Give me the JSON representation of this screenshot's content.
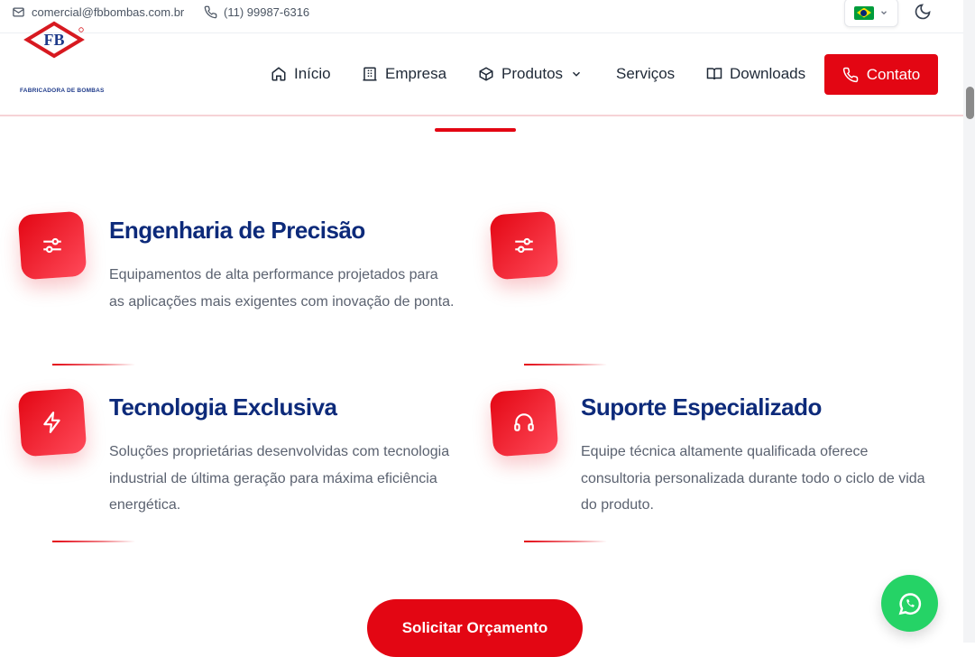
{
  "topbar": {
    "email": "comercial@fbbombas.com.br",
    "phone": "(11) 99987-6316"
  },
  "brand": {
    "logo_letters": "FB",
    "tagline": "FABRICADORA DE BOMBAS"
  },
  "nav": {
    "items": [
      {
        "label": "Início",
        "icon": "home-icon"
      },
      {
        "label": "Empresa",
        "icon": "building-icon"
      },
      {
        "label": "Produtos",
        "icon": "package-icon"
      },
      {
        "label": "Serviços",
        "icon": ""
      },
      {
        "label": "Downloads",
        "icon": "book-icon"
      }
    ],
    "contact_label": "Contato"
  },
  "features": [
    {
      "icon": "sliders-icon",
      "title": "Engenharia de Precisão",
      "description": "Equipamentos de alta performance projetados para as aplicações mais exigentes com inovação de ponta."
    },
    {
      "icon": "sliders-icon",
      "title": "",
      "description": ""
    },
    {
      "icon": "lightning-icon",
      "title": "Tecnologia Exclusiva",
      "description": "Soluções proprietárias desenvolvidas com tecnologia industrial de última geração para máxima eficiência energética."
    },
    {
      "icon": "headset-icon",
      "title": "Suporte Especializado",
      "description": "Equipe técnica altamente qualificada oferece consultoria personalizada durante todo o ciclo de vida do produto."
    }
  ],
  "cta_label": "Solicitar Orçamento",
  "colors": {
    "accent": "#e30613",
    "title": "#0d2a7a",
    "whatsapp": "#25d366"
  }
}
